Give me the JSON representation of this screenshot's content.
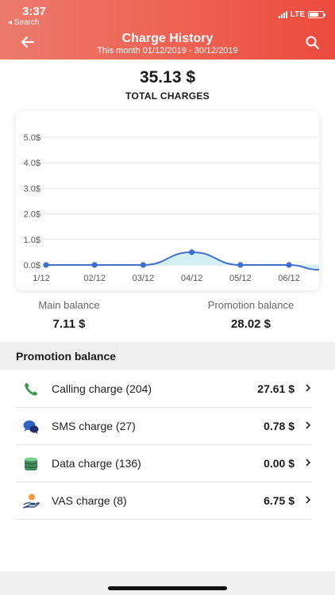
{
  "status": {
    "time": "3:37",
    "back_app": "◂ Search",
    "network": "LTE"
  },
  "header": {
    "title": "Charge History",
    "subtitle": "This month 01/12/2019 - 30/12/2019"
  },
  "total": {
    "amount": "35.13 $",
    "label": "TOTAL CHARGES"
  },
  "chart_data": {
    "type": "area",
    "categories": [
      "01/12",
      "02/12",
      "03/12",
      "04/12",
      "05/12",
      "06/12"
    ],
    "tick_labels": [
      "1/12",
      "02/12",
      "03/12",
      "04/12",
      "05/12",
      "06/12"
    ],
    "values": [
      0.0,
      0.0,
      0.0,
      0.5,
      0.0,
      0.0
    ],
    "yticks": [
      "0.0$",
      "1.0$",
      "2.0$",
      "3.0$",
      "4.0$",
      "5.0$"
    ],
    "ylim": [
      0,
      5
    ],
    "grid": true,
    "color": "#3f6fd1",
    "fill": "#cdeef3"
  },
  "balances": {
    "main": {
      "label": "Main balance",
      "value": "7.11 $"
    },
    "promo": {
      "label": "Promotion balance",
      "value": "28.02 $"
    }
  },
  "section": {
    "title": "Promotion balance"
  },
  "charges": [
    {
      "name": "Calling charge (204)",
      "amount": "27.61 $",
      "icon": "phone-icon"
    },
    {
      "name": "SMS charge (27)",
      "amount": "0.78 $",
      "icon": "chat-bubbles-icon"
    },
    {
      "name": "Data charge (136)",
      "amount": "0.00 $",
      "icon": "database-icon"
    },
    {
      "name": "VAS charge (8)",
      "amount": "6.75 $",
      "icon": "hand-coin-icon"
    }
  ],
  "colors": {
    "accent": "#ee5f4f",
    "line": "#3f6fd1"
  }
}
